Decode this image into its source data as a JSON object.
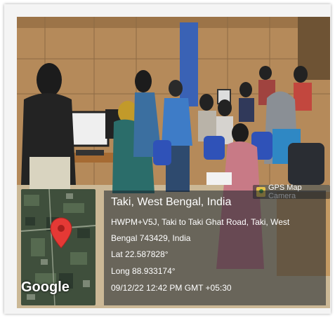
{
  "camera_badge": {
    "label": "GPS Map Camera",
    "logo_icon": "gps-map-camera-logo-icon"
  },
  "map": {
    "brand": "Google",
    "pin_icon": "location-pin-icon",
    "pin_color": "#e53935"
  },
  "location": {
    "title": "Taki, West Bengal, India",
    "address_line1": "HWPM+V5J, Taki to Taki Ghat Road, Taki, West",
    "address_line2": "Bengal 743429, India",
    "latitude": "Lat 22.587828°",
    "longitude": "Long 88.933174°",
    "datetime": "09/12/22 12:42 PM GMT +05:30"
  }
}
